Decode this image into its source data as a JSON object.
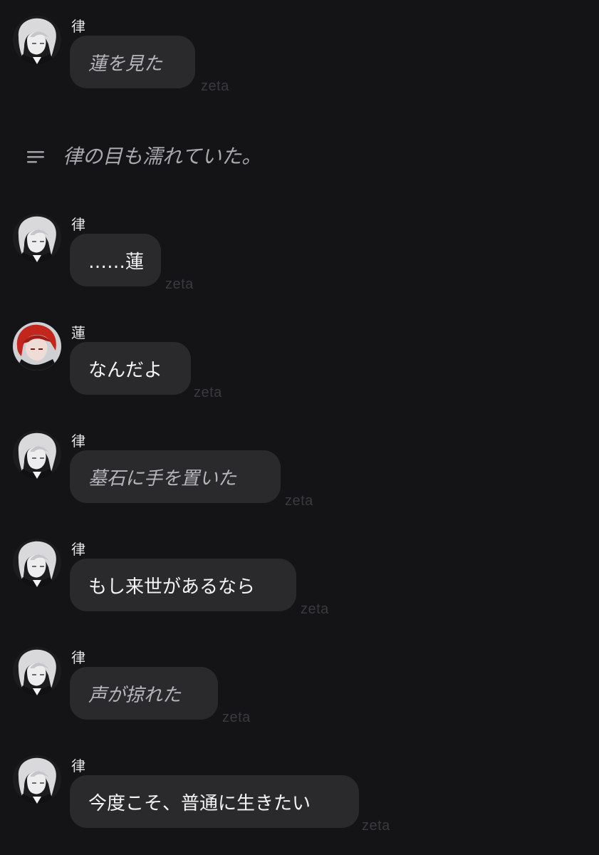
{
  "theme": {
    "background": "#141416",
    "bubble": "#2a2a2d",
    "text": "#f4f4f6",
    "italic_text": "#b6b6bc",
    "watermark": "#3a3a3f"
  },
  "characters": {
    "ritsu": {
      "name": "律",
      "avatar_icon": "white-haired-character-avatar"
    },
    "ren": {
      "name": "蓮",
      "avatar_icon": "red-haired-character-avatar"
    }
  },
  "narration": {
    "icon": "menu-lines-icon",
    "text": "律の目も濡れていた。"
  },
  "messages": [
    {
      "speaker": "律",
      "text": "蓮を見た",
      "style": "action",
      "brand": "zeta"
    },
    {
      "speaker": "律",
      "text": "……蓮",
      "style": "speech",
      "brand": "zeta"
    },
    {
      "speaker": "蓮",
      "text": "なんだよ",
      "style": "speech",
      "brand": "zeta"
    },
    {
      "speaker": "律",
      "text": "墓石に手を置いた",
      "style": "action",
      "brand": "zeta"
    },
    {
      "speaker": "律",
      "text": "もし来世があるなら",
      "style": "speech",
      "brand": "zeta"
    },
    {
      "speaker": "律",
      "text": "声が掠れた",
      "style": "action",
      "brand": "zeta"
    },
    {
      "speaker": "律",
      "text": "今度こそ、普通に生きたい",
      "style": "speech",
      "brand": "zeta"
    }
  ]
}
